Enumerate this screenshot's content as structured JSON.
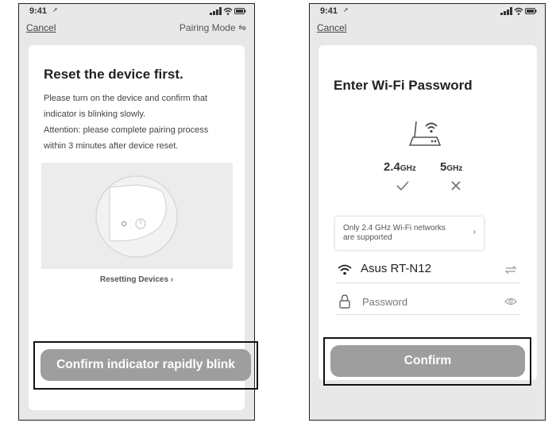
{
  "left_screen": {
    "status_time": "9:41",
    "cancel_label": "Cancel",
    "pairing_mode_label": "Pairing Mode ⇋",
    "title": "Reset the device first.",
    "instruction_line1": "Please turn on the device and confirm that",
    "instruction_line2": "indicator is blinking slowly.",
    "attention_line1": "Attention: please complete pairing process",
    "attention_line2": "within 3 minutes after device reset.",
    "resetting_link": "Resetting Devices ›",
    "confirm_button": "Confirm indicator rapidly blink"
  },
  "right_screen": {
    "status_time": "9:41",
    "cancel_label": "Cancel",
    "title": "Enter Wi-Fi Password",
    "band_24_number": "2.4",
    "band_24_unit": "GHz",
    "band_5_number": "5",
    "band_5_unit": "GHz",
    "note_line1": "Only 2.4 GHz Wi-Fi networks",
    "note_line2": "are supported",
    "note_chevron": "›",
    "ssid": "Asus RT-N12",
    "password_placeholder": "Password",
    "confirm_button": "Confirm"
  },
  "icons": {
    "status": [
      "location-arrow-icon",
      "signal-icon",
      "wifi-icon",
      "battery-icon"
    ],
    "band_24_status": "check-icon",
    "band_5_status": "x-icon"
  },
  "colors": {
    "button": "#9e9e9e",
    "screen_background": "#e8e8e8",
    "card": "#ffffff"
  }
}
